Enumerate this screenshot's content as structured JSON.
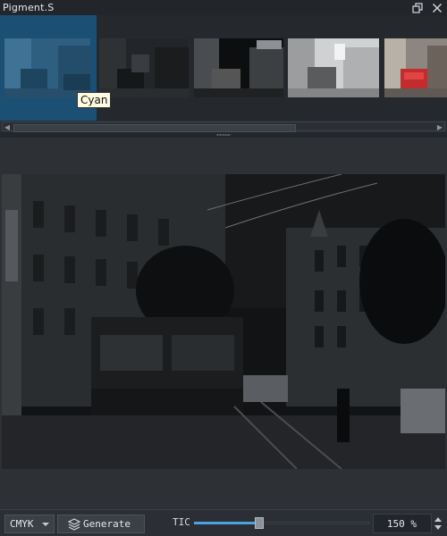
{
  "window": {
    "title": "Pigment.S"
  },
  "thumbnails": [
    {
      "name": "Cyan",
      "selected": true
    },
    {
      "selected": false
    },
    {
      "selected": false
    },
    {
      "selected": false
    },
    {
      "selected": false
    }
  ],
  "tooltip": "Cyan",
  "toolbar": {
    "mode_value": "CMYK",
    "generate_label": "Generate",
    "tic_label": "TIC",
    "tic_fraction": 0.37,
    "zoom_value": "150 %"
  },
  "colors": {
    "accent": "#4aa3df",
    "selection": "#1b4f73",
    "background": "#2b2f35"
  },
  "icons": [
    "restore-window-icon",
    "close-icon",
    "layers-icon",
    "chevron-down-icon",
    "spin-up-icon",
    "spin-down-icon"
  ]
}
